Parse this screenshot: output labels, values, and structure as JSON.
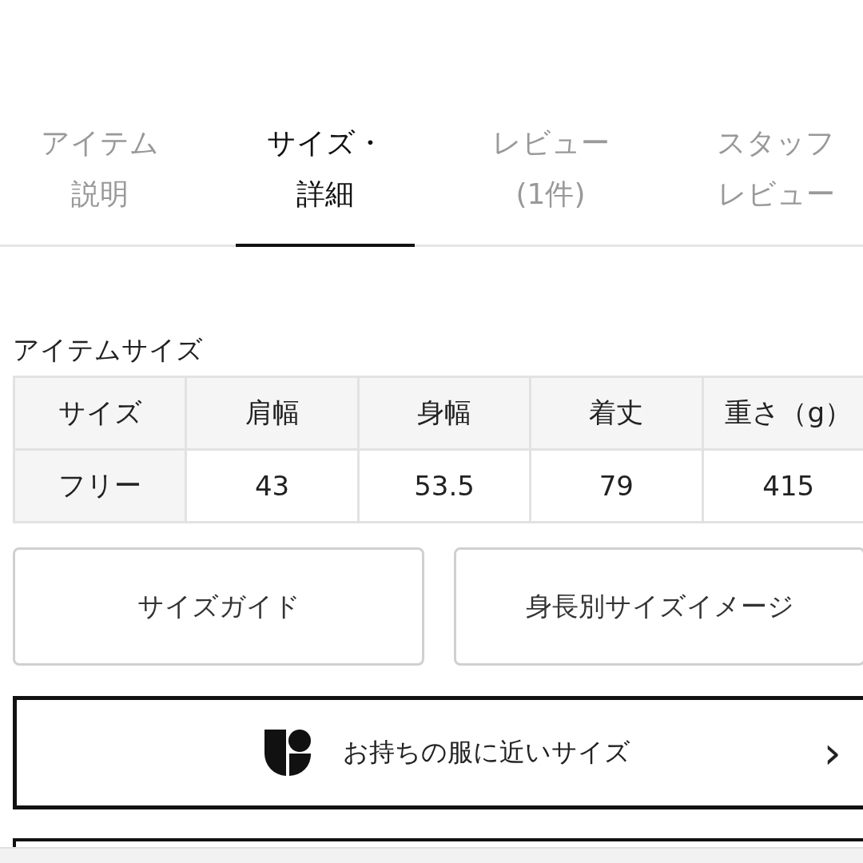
{
  "tabs": [
    {
      "lines": [
        "アイテム",
        "説明"
      ],
      "selected": false
    },
    {
      "lines": [
        "サイズ・",
        "詳細"
      ],
      "selected": true
    },
    {
      "lines": [
        "レビュー",
        "(1件)"
      ],
      "selected": false
    },
    {
      "lines": [
        "スタッフ",
        "レビュー"
      ],
      "selected": false
    }
  ],
  "size_section": {
    "title": "アイテムサイズ",
    "table": {
      "columns": [
        "サイズ",
        "肩幅",
        "身幅",
        "着丈",
        "重さ（g）"
      ],
      "rows": [
        [
          "フリー",
          "43",
          "53.5",
          "79",
          "415"
        ]
      ]
    }
  },
  "buttons": [
    "サイズガイド",
    "身長別サイズイメージ"
  ],
  "similar_size_link": {
    "label": "お持ちの服に近いサイズ",
    "chevron": "›"
  }
}
